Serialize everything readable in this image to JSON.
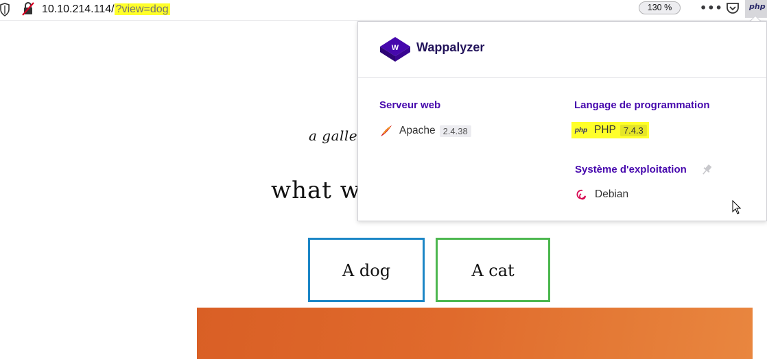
{
  "browser": {
    "url_host": "10.10.214.114/",
    "url_query": "?view=dog",
    "zoom": "130 %",
    "php_button_label": "php"
  },
  "page": {
    "gallery_text": "a galler",
    "headline": "what wo",
    "choices": [
      "A dog",
      "A cat"
    ]
  },
  "wappalyzer": {
    "brand": "Wappalyzer",
    "categories": [
      {
        "title": "Serveur web",
        "tech": {
          "name": "Apache",
          "version": "2.4.38",
          "icon": "apache-feather-icon"
        }
      },
      {
        "title": "Langage de programmation",
        "tech": {
          "name": "PHP",
          "version": "7.4.3",
          "icon": "php-icon"
        }
      },
      {
        "title": "Système d'exploitation",
        "tech": {
          "name": "Debian",
          "version": "",
          "icon": "debian-swirl-icon"
        }
      }
    ],
    "php_logo_text": "php"
  },
  "colors": {
    "highlight": "#ffff2a",
    "wappalyzer_purple": "#4608ad",
    "dog_border": "#1b86c6",
    "cat_border": "#4cb74f"
  }
}
